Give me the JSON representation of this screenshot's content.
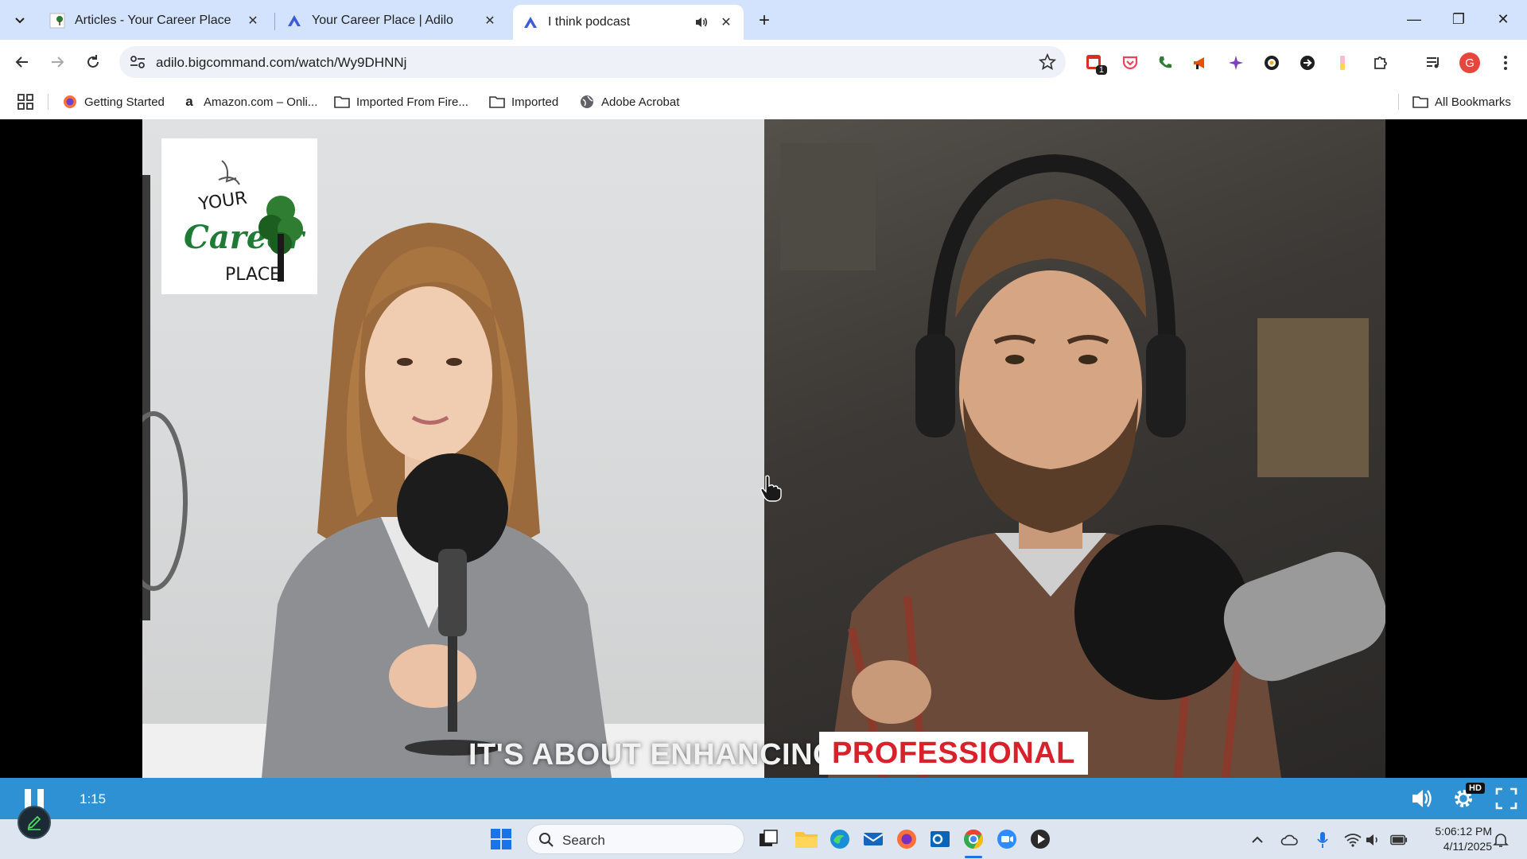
{
  "browser": {
    "tabs": [
      {
        "title": "Articles - Your Career Place",
        "close": "✕"
      },
      {
        "title": "Your Career Place | Adilo",
        "close": "✕"
      },
      {
        "title": "I think podcast",
        "close": "✕"
      }
    ],
    "new_tab": "+",
    "window_controls": {
      "minimize": "—",
      "restore": "❐",
      "close": "✕"
    },
    "url": "adilo.bigcommand.com/watch/Wy9DHNNj",
    "extension_badge": "1",
    "profile_initial": "G",
    "bookmarks": [
      {
        "label": "Getting Started",
        "icon": "firefox-icon"
      },
      {
        "label": "Amazon.com – Onli...",
        "icon": "amazon-icon"
      },
      {
        "label": "Imported From Fire...",
        "icon": "folder-icon"
      },
      {
        "label": "Imported",
        "icon": "folder-icon"
      },
      {
        "label": "Adobe Acrobat",
        "icon": "globe-icon"
      }
    ],
    "all_bookmarks": "All Bookmarks"
  },
  "video": {
    "logo": {
      "line1": "YOUR",
      "line2": "Career",
      "line3": "PLACE"
    },
    "caption_plain": "IT'S ABOUT ENHANCING",
    "caption_highlight": "PROFESSIONAL",
    "timecode": "1:15",
    "quality_badge": "HD"
  },
  "taskbar": {
    "search_placeholder": "Search",
    "time": "5:06:12 PM",
    "date": "4/11/2025"
  },
  "colors": {
    "tabstrip": "#d3e3fd",
    "player_bar": "#2e91d3",
    "caption_highlight_text": "#d8212a",
    "taskbar": "#dde6f0"
  }
}
